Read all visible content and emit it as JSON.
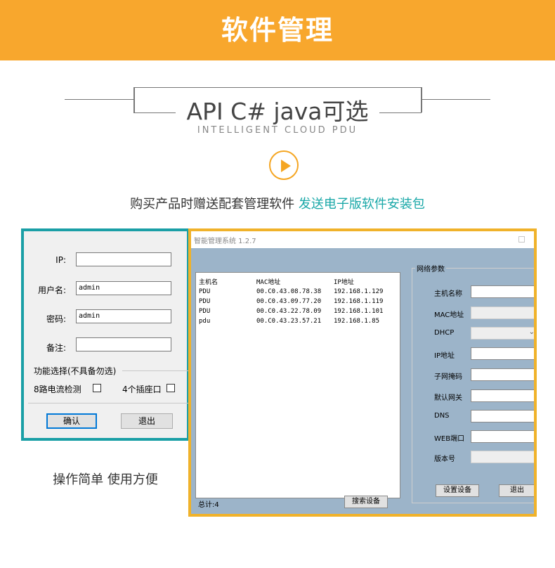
{
  "banner": {
    "title": "软件管理"
  },
  "heading": {
    "title": "API C# java可选",
    "subtitle": "INTELLIGENT CLOUD PDU"
  },
  "buy": {
    "text": "购买产品时赠送配套管理软件 ",
    "highlight": "发送电子版软件安装包"
  },
  "colors": {
    "banner": "#f8a72d",
    "accent_teal": "#1a9fa6",
    "accent_gold": "#f0b22a",
    "highlight_text": "#1aa8a8"
  },
  "left_dialog": {
    "ip_label": "IP:",
    "ip_value": "",
    "user_label": "用户名:",
    "user_value": "admin",
    "pwd_label": "密码:",
    "pwd_value": "admin",
    "note_label": "备注:",
    "note_value": "",
    "func_title": "功能选择(不具备勿选)",
    "option1": "8路电流检测",
    "option2": "4个插座口",
    "confirm": "确认",
    "exit": "退出"
  },
  "left_caption": "操作简单 使用方便",
  "right_window": {
    "title": "智能管理系统 1.2.7",
    "columns": [
      "主机名",
      "MAC地址",
      "IP地址"
    ],
    "rows": [
      [
        "PDU",
        "00.C0.43.08.78.38",
        "192.168.1.129"
      ],
      [
        "PDU",
        "00.C0.43.09.77.20",
        "192.168.1.119"
      ],
      [
        "PDU",
        "00.C0.43.22.78.09",
        "192.168.1.101"
      ],
      [
        "pdu",
        "00.C0.43.23.57.21",
        "192.168.1.85"
      ]
    ],
    "count_label": "总计:4",
    "search_button": "搜索设备",
    "net_title": "网络参数",
    "net_fields": [
      "主机名称",
      "MAC地址",
      "DHCP",
      "IP地址",
      "子网掩码",
      "默认网关",
      "DNS",
      "WEB端口",
      "版本号"
    ],
    "set_button": "设置设备",
    "exit_button": "退出"
  }
}
